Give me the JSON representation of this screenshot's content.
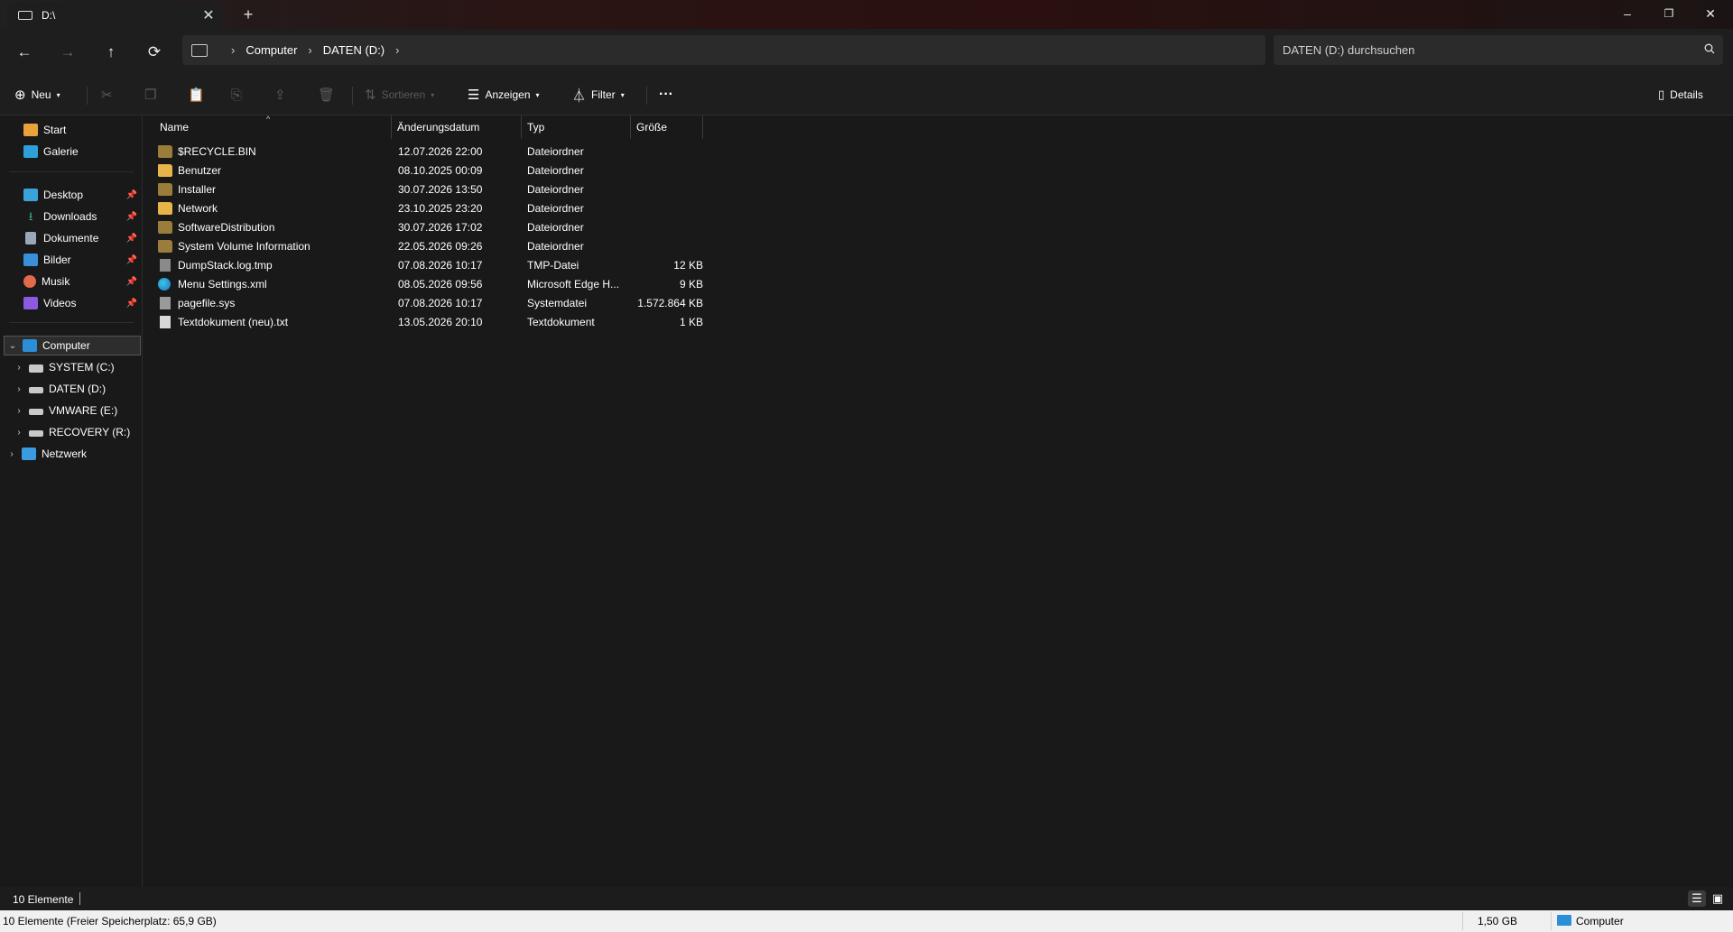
{
  "tab": {
    "title": "D:\\",
    "close": "✕",
    "new": "+"
  },
  "window_controls": {
    "minimize": "–",
    "restore": "❐",
    "close": "✕"
  },
  "nav": {
    "back": "←",
    "forward": "→",
    "up": "↑",
    "refresh": "⟳"
  },
  "breadcrumb": {
    "sep": "›",
    "items": [
      "Computer",
      "DATEN (D:)"
    ]
  },
  "search": {
    "placeholder": "DATEN (D:) durchsuchen"
  },
  "toolbar": {
    "new_label": "Neu",
    "sort_label": "Sortieren",
    "view_label": "Anzeigen",
    "filter_label": "Filter",
    "more": "···",
    "details_label": "Details"
  },
  "sidebar": {
    "quick": [
      {
        "label": "Start"
      },
      {
        "label": "Galerie"
      }
    ],
    "pinned": [
      {
        "label": "Desktop"
      },
      {
        "label": "Downloads"
      },
      {
        "label": "Dokumente"
      },
      {
        "label": "Bilder"
      },
      {
        "label": "Musik"
      },
      {
        "label": "Videos"
      }
    ],
    "computer": "Computer",
    "drives": [
      {
        "label": "SYSTEM (C:)"
      },
      {
        "label": "DATEN (D:)"
      },
      {
        "label": "VMWARE (E:)"
      },
      {
        "label": "RECOVERY (R:)"
      }
    ],
    "network": "Netzwerk"
  },
  "columns": {
    "name": "Name",
    "date": "Änderungsdatum",
    "type": "Typ",
    "size": "Größe"
  },
  "files": [
    {
      "name": "$RECYCLE.BIN",
      "date": "12.07.2026 22:00",
      "type": "Dateiordner",
      "size": ""
    },
    {
      "name": "Benutzer",
      "date": "08.10.2025 00:09",
      "type": "Dateiordner",
      "size": ""
    },
    {
      "name": "Installer",
      "date": "30.07.2026 13:50",
      "type": "Dateiordner",
      "size": ""
    },
    {
      "name": "Network",
      "date": "23.10.2025 23:20",
      "type": "Dateiordner",
      "size": ""
    },
    {
      "name": "SoftwareDistribution",
      "date": "30.07.2026 17:02",
      "type": "Dateiordner",
      "size": ""
    },
    {
      "name": "System Volume Information",
      "date": "22.05.2026 09:26",
      "type": "Dateiordner",
      "size": ""
    },
    {
      "name": "DumpStack.log.tmp",
      "date": "07.08.2026 10:17",
      "type": "TMP-Datei",
      "size": "12 KB"
    },
    {
      "name": "Menu Settings.xml",
      "date": "08.05.2026 09:56",
      "type": "Microsoft Edge H...",
      "size": "9 KB"
    },
    {
      "name": "pagefile.sys",
      "date": "07.08.2026 10:17",
      "type": "Systemdatei",
      "size": "1.572.864 KB"
    },
    {
      "name": "Textdokument (neu).txt",
      "date": "13.05.2026 20:10",
      "type": "Textdokument",
      "size": "1 KB"
    }
  ],
  "status": {
    "count": "10 Elemente"
  },
  "infobar": {
    "left": "10 Elemente (Freier Speicherplatz: 65,9 GB)",
    "size": "1,50 GB",
    "location": "Computer"
  }
}
